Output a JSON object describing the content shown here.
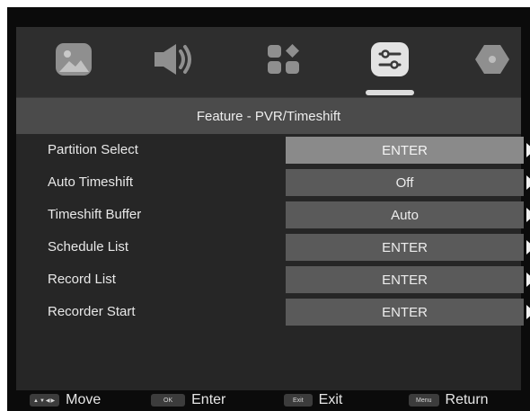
{
  "tabs": [
    {
      "icon": "picture-icon",
      "active": false
    },
    {
      "icon": "speaker-icon",
      "active": false
    },
    {
      "icon": "apps-icon",
      "active": false
    },
    {
      "icon": "settings-sliders-icon",
      "active": true
    },
    {
      "icon": "hexagon-icon",
      "active": false
    }
  ],
  "page_title": "Feature - PVR/Timeshift",
  "menu_items": [
    {
      "label": "Partition Select",
      "value": "ENTER",
      "selected": true
    },
    {
      "label": "Auto Timeshift",
      "value": "Off",
      "selected": false
    },
    {
      "label": "Timeshift Buffer",
      "value": "Auto",
      "selected": false
    },
    {
      "label": "Schedule List",
      "value": "ENTER",
      "selected": false
    },
    {
      "label": "Record List",
      "value": "ENTER",
      "selected": false
    },
    {
      "label": "Recorder Start",
      "value": "ENTER",
      "selected": false
    }
  ],
  "help_bar": {
    "move": {
      "key": "▲▼◀▶",
      "label": "Move"
    },
    "enter": {
      "key": "OK",
      "label": "Enter"
    },
    "exit": {
      "key": "Exit",
      "label": "Exit"
    },
    "return": {
      "key": "Menu",
      "label": "Return"
    }
  },
  "colors": {
    "background": "#0b0b0b",
    "icon_bar": "#2e2e2e",
    "title_bar": "#4b4b4b",
    "panel": "#262626",
    "value_box": "#5a5a5a",
    "value_box_selected": "#8a8a8a"
  }
}
